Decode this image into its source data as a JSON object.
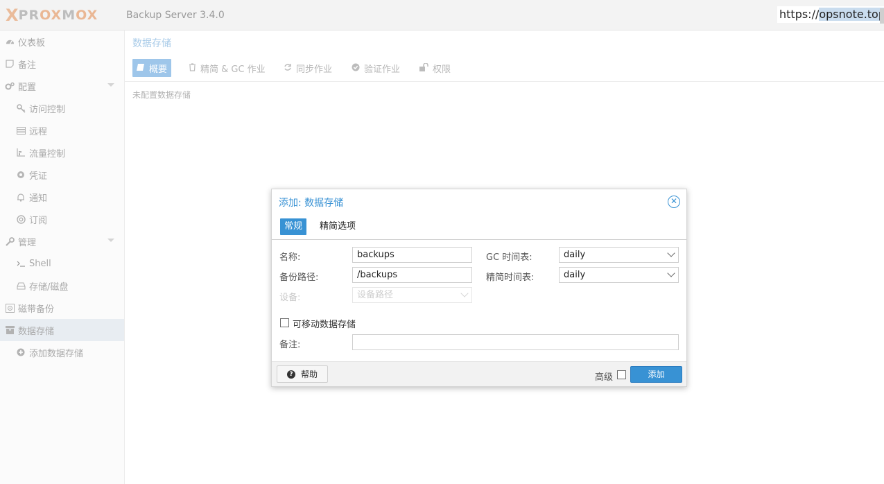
{
  "header": {
    "logo_x": "X",
    "logo_pr": "PR",
    "logo_ox1": "OX",
    "logo_m": "M",
    "logo_ox2": "OX",
    "version": "Backup Server 3.4.0",
    "url_prefix": "https://",
    "url_highlight": "opsnote.top"
  },
  "sidebar": {
    "items": [
      {
        "label": "仪表板",
        "icon": "dashboard-icon"
      },
      {
        "label": "备注",
        "icon": "note-icon"
      },
      {
        "label": "配置",
        "icon": "gears-icon"
      },
      {
        "label": "访问控制",
        "icon": "key-icon"
      },
      {
        "label": "远程",
        "icon": "server-icon"
      },
      {
        "label": "流量控制",
        "icon": "chart-icon"
      },
      {
        "label": "凭证",
        "icon": "certificate-icon"
      },
      {
        "label": "通知",
        "icon": "bell-icon"
      },
      {
        "label": "订阅",
        "icon": "support-icon"
      },
      {
        "label": "管理",
        "icon": "wrench-icon"
      },
      {
        "label": "Shell",
        "icon": "terminal-icon"
      },
      {
        "label": "存储/磁盘",
        "icon": "hdd-icon"
      },
      {
        "label": "磁带备份",
        "icon": "tape-icon"
      },
      {
        "label": "数据存储",
        "icon": "archive-icon"
      },
      {
        "label": "添加数据存储",
        "icon": "plus-circle-icon"
      }
    ]
  },
  "main": {
    "title": "数据存储",
    "tabs": [
      {
        "label": "概要",
        "icon": "book-icon"
      },
      {
        "label": "精简 & GC 作业",
        "icon": "trash-icon"
      },
      {
        "label": "同步作业",
        "icon": "refresh-icon"
      },
      {
        "label": "验证作业",
        "icon": "check-circle-icon"
      },
      {
        "label": "权限",
        "icon": "unlock-icon"
      }
    ],
    "empty_text": "未配置数据存储"
  },
  "dialog": {
    "title": "添加: 数据存储",
    "tabs": [
      "常规",
      "精简选项"
    ],
    "fields": {
      "name_label": "名称:",
      "name_value": "backups",
      "path_label": "备份路径:",
      "path_value": "/backups",
      "device_label": "设备:",
      "device_placeholder": "设备路径",
      "gc_label": "GC 时间表:",
      "gc_value": "daily",
      "prune_label": "精简时间表:",
      "prune_value": "daily",
      "removable_label": "可移动数据存储",
      "comment_label": "备注:",
      "comment_value": ""
    },
    "footer": {
      "help": "帮助",
      "advanced": "高级",
      "add": "添加"
    }
  }
}
